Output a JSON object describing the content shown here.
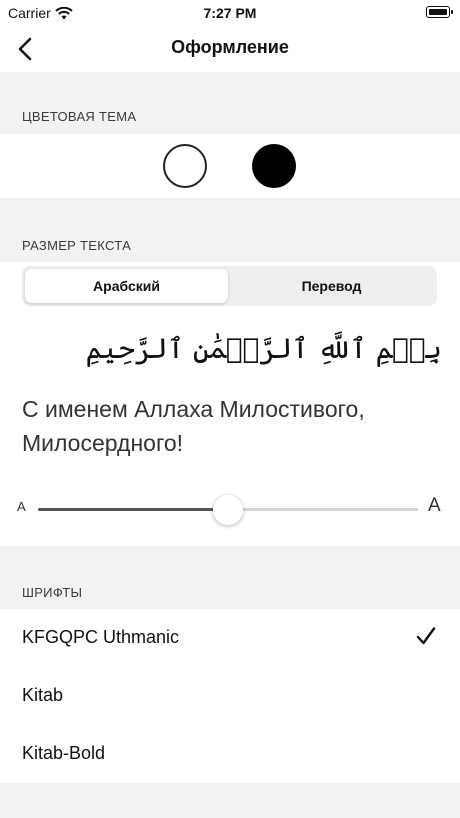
{
  "status_bar": {
    "carrier": "Carrier",
    "time": "7:27 PM"
  },
  "nav": {
    "title": "Оформление"
  },
  "color_theme": {
    "header": "ЦВЕТОВАЯ ТЕМА",
    "options": [
      {
        "name": "light",
        "color": "#ffffff"
      },
      {
        "name": "dark",
        "color": "#000000"
      }
    ]
  },
  "text_size": {
    "header": "РАЗМЕР ТЕКСТА",
    "segments": [
      "Арабский",
      "Перевод"
    ],
    "selected_segment": "Арабский",
    "arabic_preview": "بِسۡمِ ٱللَّهِ ٱلرَّحۡمَٰنِ ٱلرَّحِيمِ",
    "translation_preview": "С именем Аллаха Милостивого, Милосердного!",
    "slider": {
      "min_label": "A",
      "max_label": "A",
      "value": 0.5
    }
  },
  "fonts": {
    "header": "ШРИФТЫ",
    "items": [
      "KFGQPC Uthmanic",
      "Kitab",
      "Kitab-Bold"
    ],
    "selected": "KFGQPC Uthmanic"
  }
}
